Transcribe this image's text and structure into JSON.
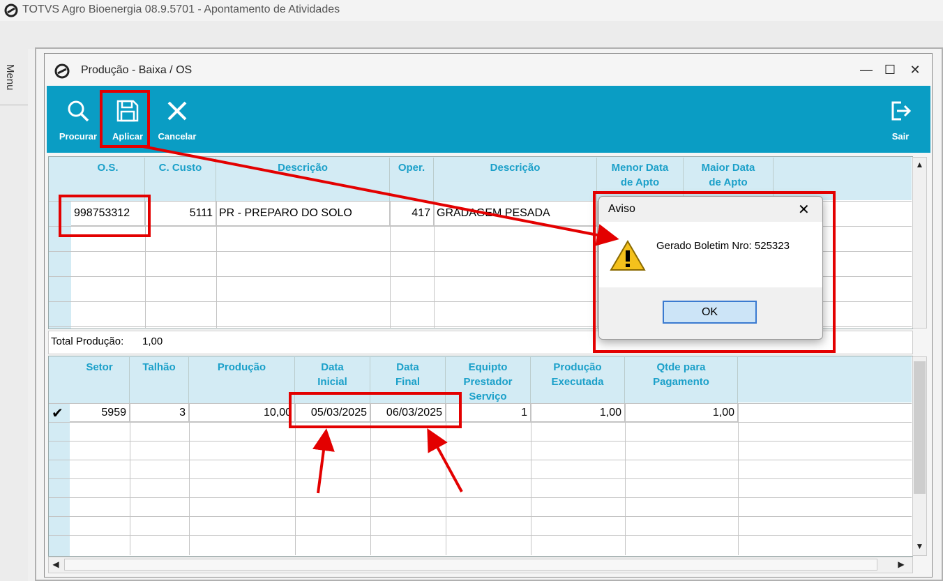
{
  "app": {
    "title": "TOTVS Agro Bioenergia 08.9.5701 - Apontamento de Atividades",
    "menu_label": "Menu"
  },
  "window": {
    "title": "Produção - Baixa / OS",
    "minimize": "—",
    "maximize": "☐",
    "close": "✕"
  },
  "toolbar": {
    "procurar": "Procurar",
    "aplicar": "Aplicar",
    "cancelar": "Cancelar",
    "sair": "Sair",
    "accent": "#0a9dc4"
  },
  "grid1": {
    "headers": {
      "os": "O.S.",
      "c_custo": "C. Custo",
      "descricao": "Descrição",
      "oper": "Oper.",
      "descricao2": "Descrição",
      "menor_data_1": "Menor Data",
      "menor_data_2": "de Apto",
      "maior_data_1": "Maior Data",
      "maior_data_2": "de Apto"
    },
    "row": {
      "os": "998753312",
      "c_custo": "5111",
      "descricao": "PR - PREPARO DO SOLO",
      "oper": "417",
      "descricao2": "GRADAGEM PESADA"
    }
  },
  "total": {
    "label": "Total Produção:",
    "value": "1,00"
  },
  "grid2": {
    "headers": {
      "setor": "Setor",
      "talhao": "Talhão",
      "producao": "Produção",
      "data_inicial_1": "Data",
      "data_inicial_2": "Inicial",
      "data_final_1": "Data",
      "data_final_2": "Final",
      "equipto_1": "Equipto",
      "equipto_2": "Prestador",
      "equipto_3": "Serviço",
      "prod_exec_1": "Produção",
      "prod_exec_2": "Executada",
      "qtde_1": "Qtde para",
      "qtde_2": "Pagamento"
    },
    "row": {
      "check": "✔",
      "setor": "5959",
      "talhao": "3",
      "producao": "10,00",
      "data_inicial": "05/03/2025",
      "data_final": "06/03/2025",
      "equipto": "1",
      "prod_exec": "1,00",
      "qtde": "1,00"
    }
  },
  "dialog": {
    "title": "Aviso",
    "close": "✕",
    "message": "Gerado Boletim Nro: 525323",
    "ok": "OK"
  },
  "colors": {
    "annotation": "#e30000",
    "header_bg": "#d3ebf4",
    "header_text": "#1ba0c9"
  }
}
